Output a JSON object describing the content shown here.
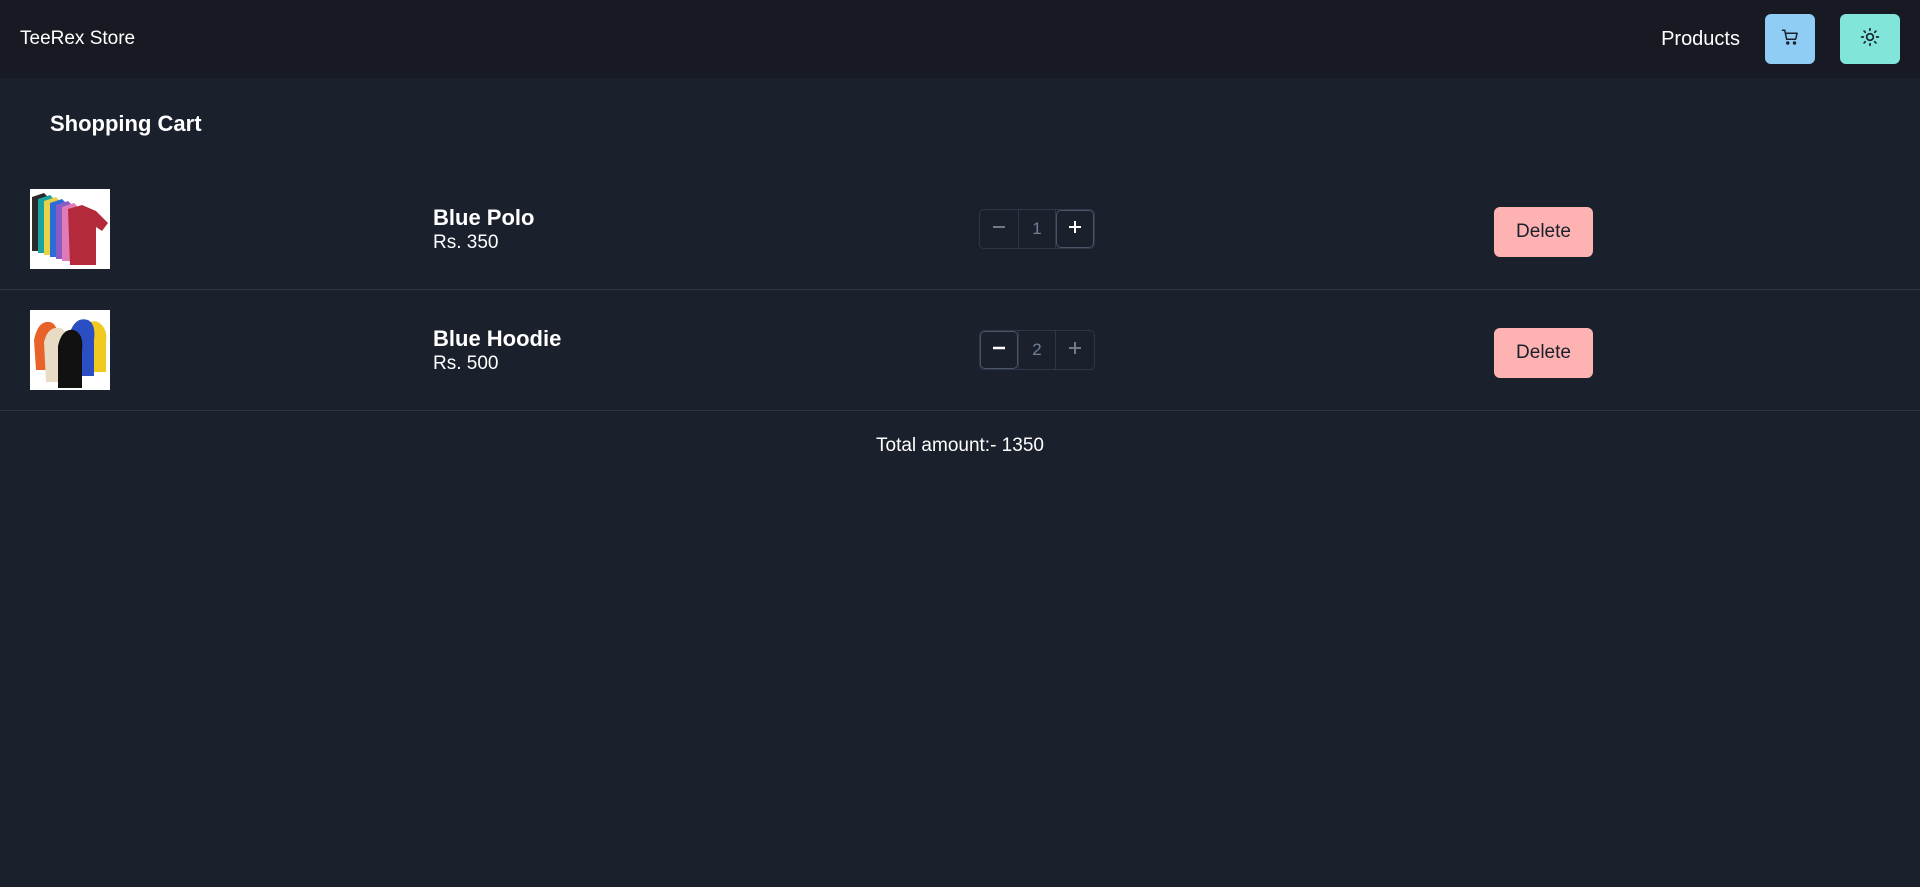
{
  "header": {
    "brand": "TeeRex Store",
    "products_link": "Products",
    "cart_icon": "cart-icon",
    "theme_icon": "sun-icon"
  },
  "cart": {
    "title": "Shopping Cart",
    "items": [
      {
        "name": "Blue Polo",
        "price": "Rs. 350",
        "quantity": "1",
        "delete_label": "Delete",
        "image": "polo-shirts-image"
      },
      {
        "name": "Blue Hoodie",
        "price": "Rs. 500",
        "quantity": "2",
        "delete_label": "Delete",
        "image": "hoodies-image"
      }
    ],
    "total_label": "Total amount:- 1350"
  },
  "colors": {
    "background": "#1a202c",
    "navbar": "#171923",
    "cart_button": "#90cdf4",
    "theme_button": "#81e6d9",
    "delete_button": "#feb2b2"
  }
}
